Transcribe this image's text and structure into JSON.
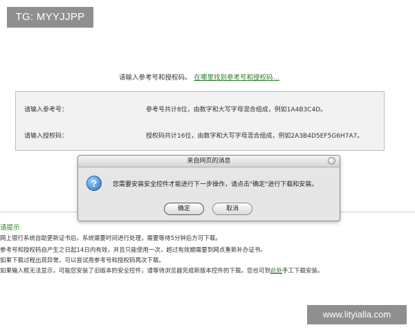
{
  "watermark_tag": "TG: MYYJJPP",
  "prompt": {
    "text": "请输入参考号和授权码。",
    "link": "在哪里找到参考号和授权码…"
  },
  "panel": {
    "ref_label": "请输入参考号：",
    "ref_hint": "参考号共计8位，由数字和大写字母混合组成，例如1A4B3C4D。",
    "auth_label": "请输入授权码：",
    "auth_hint": "授权码共计16位，由数字和大写字母混合组成，例如2A3B4D5EF5G6H7A7。"
  },
  "dialog": {
    "title": "来自网页的消息",
    "message": "您需要安装安全控件才能进行下一步操作，请点击\"确定\"进行下载和安装。",
    "ok_label": "确定",
    "cancel_label": "取消",
    "icon": "question-icon"
  },
  "tips": {
    "title": "请提示",
    "line1": "网上银行系统自助更新证书后，系统需要时间进行处理，需要等待5分钟后方可下载。",
    "line2": "参考号和授权码自产生之日起14日内有效，并且只能使用一次，超过有效期需要到网点重新补办证书。",
    "line3": "如果下载过程出现异常，可以尝试用参考号和授权码再次下载。",
    "line4_pre": "如果输入框无法显示，可能您安装了旧版本的安全控件，请等待浏览器完成新版本控件的下载。您也可到",
    "line4_link": "此处",
    "line4_post": "手工下载安装。"
  },
  "site_watermark": "www.lityialla.com"
}
